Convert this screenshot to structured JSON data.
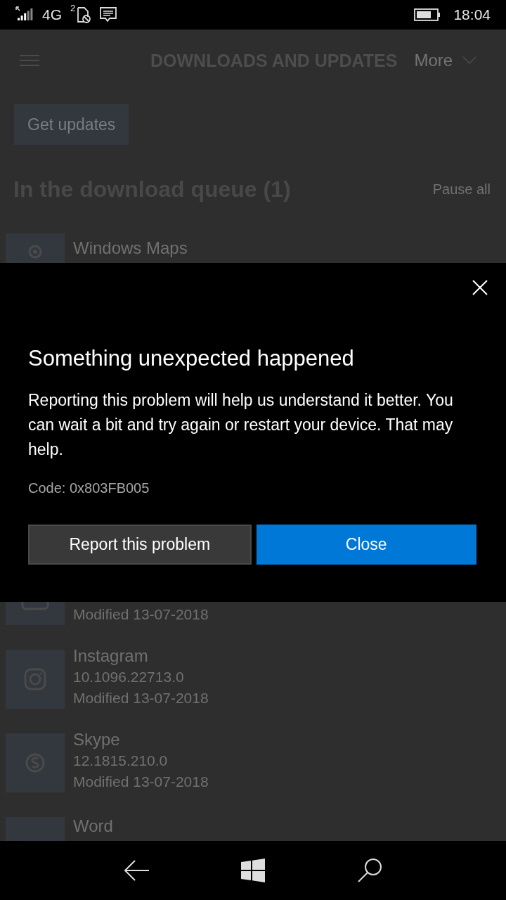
{
  "status_bar": {
    "network": "4G",
    "sim": "2",
    "time": "18:04"
  },
  "header": {
    "title": "DOWNLOADS AND UPDATES",
    "more": "More"
  },
  "get_updates": "Get updates",
  "queue": {
    "heading": "In the download queue (1)",
    "action": "Pause all"
  },
  "queue_items": [
    {
      "name": "Windows Maps"
    }
  ],
  "dialog": {
    "title": "Something unexpected happened",
    "message": "Reporting this problem will help us understand it better. You can wait a bit and try again or restart your device. That may help.",
    "code": "Code: 0x803FB005",
    "buttons": [
      {
        "label": "Report this problem",
        "kind": "secondary"
      },
      {
        "label": "Close",
        "kind": "primary"
      }
    ]
  },
  "recent_items": [
    {
      "kind": "tail",
      "modified": "Modified 13-07-2018"
    },
    {
      "kind": "full",
      "name": "Instagram",
      "version": "10.1096.22713.0",
      "modified": "Modified 13-07-2018"
    },
    {
      "kind": "full",
      "name": "Skype",
      "version": "12.1815.210.0",
      "modified": "Modified 13-07-2018"
    },
    {
      "kind": "head",
      "name": "Word"
    }
  ]
}
